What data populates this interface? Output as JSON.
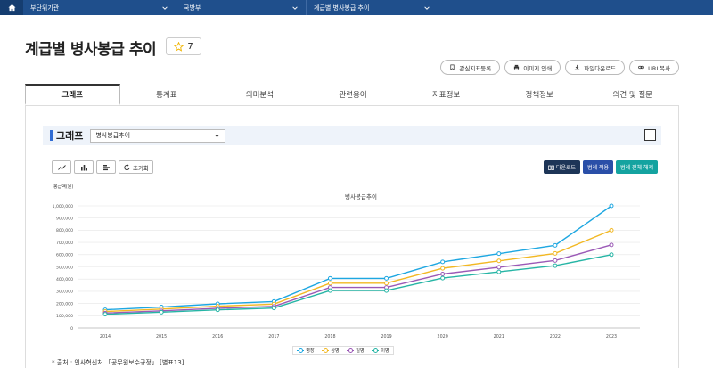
{
  "nav": {
    "crumbs": [
      {
        "label": "부단위기관"
      },
      {
        "label": "국방부"
      },
      {
        "label": "계급별 병사봉급 추이"
      }
    ]
  },
  "header": {
    "title": "계급별 병사봉급 추이",
    "fav_count": "7",
    "actions": [
      "관심지표등록",
      "이미지 인쇄",
      "파일다운로드",
      "URL복사"
    ]
  },
  "tabs": [
    "그래프",
    "통계표",
    "의미분석",
    "관련용어",
    "지표정보",
    "정책정보",
    "의견 및 질문"
  ],
  "graph": {
    "section_title": "그래프",
    "select_value": "병사봉급추이",
    "reset_label": "초기화",
    "download_label": "다운로드",
    "toggle_label": "범례 적용",
    "all_label": "범례 전체 해제"
  },
  "chart_data": {
    "type": "line",
    "title": "병사봉급추이",
    "ylabel": "봉급액(원)",
    "x": [
      "2014",
      "2015",
      "2016",
      "2017",
      "2018",
      "2019",
      "2020",
      "2021",
      "2022",
      "2023"
    ],
    "ylim": [
      0,
      1000000
    ],
    "yticks": [
      "0",
      "100,000",
      "200,000",
      "300,000",
      "400,000",
      "500,000",
      "600,000",
      "700,000",
      "800,000",
      "900,000",
      "1,000,000"
    ],
    "series": [
      {
        "name": "병장",
        "color": "#1ea7e1",
        "values": [
          149000,
          171400,
          197100,
          216000,
          405700,
          405700,
          540900,
          608500,
          676100,
          1000000
        ]
      },
      {
        "name": "상병",
        "color": "#f2b823",
        "values": [
          134600,
          154800,
          178000,
          195000,
          366200,
          366200,
          488200,
          549200,
          610200,
          800000
        ]
      },
      {
        "name": "일병",
        "color": "#9b59b6",
        "values": [
          121700,
          140000,
          161000,
          176400,
          331300,
          331300,
          441700,
          496900,
          552100,
          680000
        ]
      },
      {
        "name": "이병",
        "color": "#26b5a5",
        "values": [
          112100,
          129000,
          148300,
          163000,
          306100,
          306100,
          408100,
          459100,
          510100,
          600000
        ]
      }
    ],
    "grid": true,
    "legend": "bottom"
  },
  "source": "* 출처 : 인사혁신처 「공무원보수규정」 [별표13]"
}
